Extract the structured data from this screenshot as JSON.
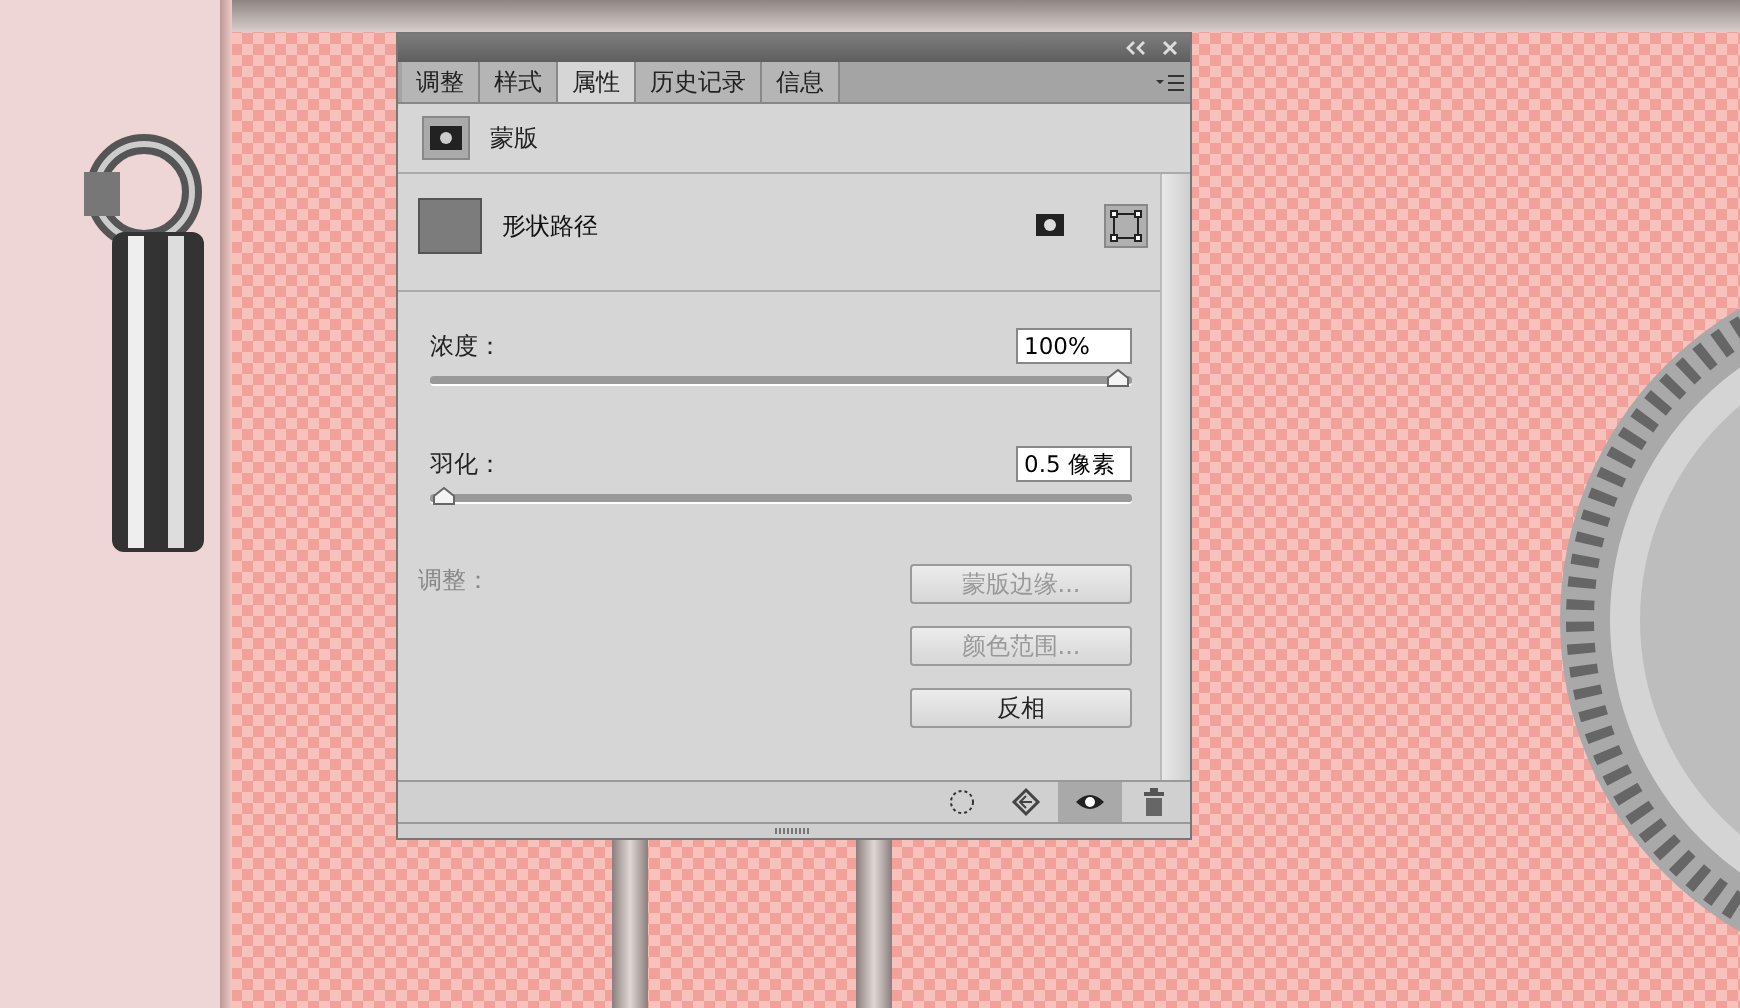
{
  "tabs": [
    {
      "label": "调整",
      "selected": false
    },
    {
      "label": "样式",
      "selected": false
    },
    {
      "label": "属性",
      "selected": true
    },
    {
      "label": "历史记录",
      "selected": false
    },
    {
      "label": "信息",
      "selected": false
    }
  ],
  "header": {
    "title": "蒙版"
  },
  "mask": {
    "name": "形状路径",
    "modes": [
      {
        "kind": "pixel",
        "selected": false
      },
      {
        "kind": "vector",
        "selected": true
      }
    ]
  },
  "density": {
    "label": "浓度：",
    "value": "100%",
    "level": 1
  },
  "feather": {
    "label": "羽化：",
    "value": "0.5 像素",
    "level": 0.02
  },
  "refine": {
    "label": "调整：",
    "disabled": true,
    "buttons": [
      {
        "label": "蒙版边缘...",
        "disabled": true
      },
      {
        "label": "颜色范围...",
        "disabled": true
      },
      {
        "label": "反相",
        "disabled": false
      }
    ]
  },
  "toolbar": [
    {
      "kind": "selection",
      "selected": false
    },
    {
      "kind": "apply",
      "selected": false
    },
    {
      "kind": "visibility",
      "selected": true
    },
    {
      "kind": "delete",
      "selected": false
    }
  ]
}
